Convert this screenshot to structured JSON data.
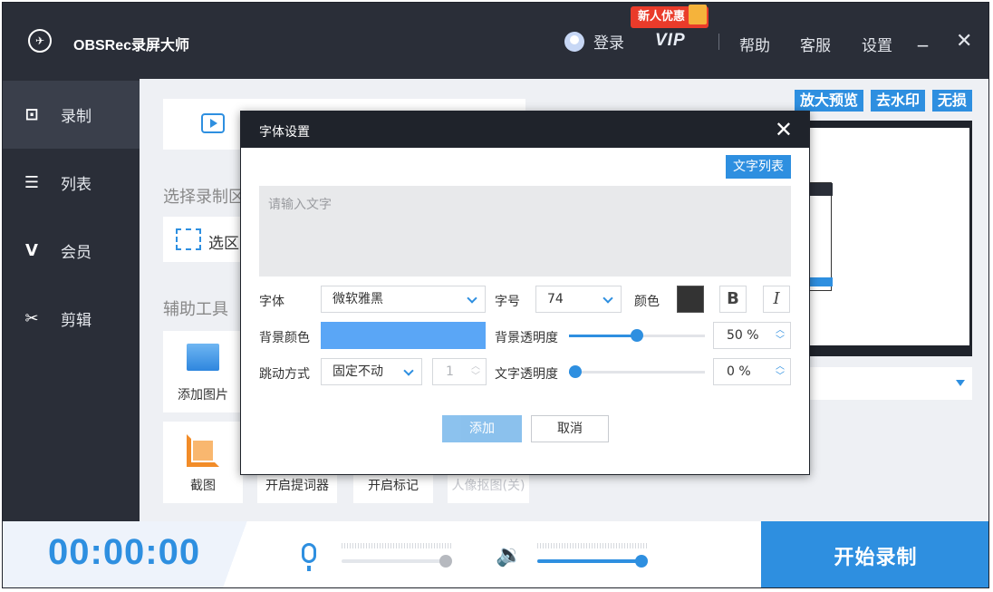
{
  "app": {
    "title": "OBSRec录屏大师"
  },
  "titlebar": {
    "login": "登录",
    "vip": "VIP",
    "new_user_badge": "新人优惠",
    "help": "帮助",
    "service": "客服",
    "settings": "设置",
    "minimize": "_",
    "close": "✕"
  },
  "sidebar": {
    "items": [
      {
        "label": "录制",
        "icon": "record-icon",
        "glyph": "⊡",
        "active": true
      },
      {
        "label": "列表",
        "icon": "list-icon",
        "glyph": "☰",
        "active": false
      },
      {
        "label": "会员",
        "icon": "vip-icon",
        "glyph": "V",
        "active": false
      },
      {
        "label": "剪辑",
        "icon": "scissors-icon",
        "glyph": "✂",
        "active": false
      }
    ]
  },
  "main": {
    "select_area_label": "选择录制区",
    "area_option": "选区",
    "tools_label": "辅助工具",
    "tools": [
      {
        "label": "添加图片"
      },
      {
        "label": "截图"
      },
      {
        "label": "开启提词器"
      },
      {
        "label": "开启标记"
      },
      {
        "label": "人像抠图(关)"
      }
    ],
    "preview_buttons": [
      "放大预览",
      "去水印",
      "无损"
    ]
  },
  "bottom": {
    "timer": "00:00:00",
    "start_record": "开始录制",
    "mic_level": 1.0,
    "speaker_level": 1.0
  },
  "modal": {
    "title": "字体设置",
    "close": "✕",
    "text_list_button": "文字列表",
    "text_placeholder": "请输入文字",
    "font_label": "字体",
    "font_value": "微软雅黑",
    "size_label": "字号",
    "size_value": "74",
    "color_label": "颜色",
    "text_color": "#333333",
    "bold": "B",
    "italic": "I",
    "bg_color_label": "背景颜色",
    "bg_color": "#5aa6f6",
    "bg_opacity_label": "背景透明度",
    "bg_opacity_value": "50 %",
    "bg_opacity": 0.5,
    "jump_label": "跳动方式",
    "jump_value": "固定不动",
    "jump_count": "1",
    "text_opacity_label": "文字透明度",
    "text_opacity_value": "0 %",
    "text_opacity": 0.0,
    "add_button": "添加",
    "cancel_button": "取消"
  },
  "colors": {
    "accent": "#2e8fe0",
    "dark": "#2a2e38",
    "red_badge": "#ea3b2a"
  }
}
